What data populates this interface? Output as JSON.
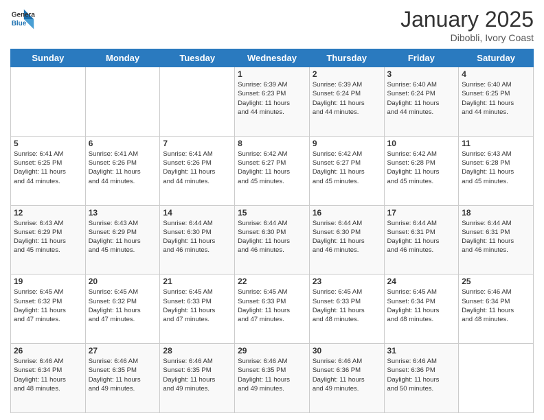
{
  "logo": {
    "line1": "General",
    "line2": "Blue"
  },
  "title": "January 2025",
  "subtitle": "Dibobli, Ivory Coast",
  "header_days": [
    "Sunday",
    "Monday",
    "Tuesday",
    "Wednesday",
    "Thursday",
    "Friday",
    "Saturday"
  ],
  "weeks": [
    [
      {
        "day": "",
        "info": ""
      },
      {
        "day": "",
        "info": ""
      },
      {
        "day": "",
        "info": ""
      },
      {
        "day": "1",
        "info": "Sunrise: 6:39 AM\nSunset: 6:23 PM\nDaylight: 11 hours\nand 44 minutes."
      },
      {
        "day": "2",
        "info": "Sunrise: 6:39 AM\nSunset: 6:24 PM\nDaylight: 11 hours\nand 44 minutes."
      },
      {
        "day": "3",
        "info": "Sunrise: 6:40 AM\nSunset: 6:24 PM\nDaylight: 11 hours\nand 44 minutes."
      },
      {
        "day": "4",
        "info": "Sunrise: 6:40 AM\nSunset: 6:25 PM\nDaylight: 11 hours\nand 44 minutes."
      }
    ],
    [
      {
        "day": "5",
        "info": "Sunrise: 6:41 AM\nSunset: 6:25 PM\nDaylight: 11 hours\nand 44 minutes."
      },
      {
        "day": "6",
        "info": "Sunrise: 6:41 AM\nSunset: 6:26 PM\nDaylight: 11 hours\nand 44 minutes."
      },
      {
        "day": "7",
        "info": "Sunrise: 6:41 AM\nSunset: 6:26 PM\nDaylight: 11 hours\nand 44 minutes."
      },
      {
        "day": "8",
        "info": "Sunrise: 6:42 AM\nSunset: 6:27 PM\nDaylight: 11 hours\nand 45 minutes."
      },
      {
        "day": "9",
        "info": "Sunrise: 6:42 AM\nSunset: 6:27 PM\nDaylight: 11 hours\nand 45 minutes."
      },
      {
        "day": "10",
        "info": "Sunrise: 6:42 AM\nSunset: 6:28 PM\nDaylight: 11 hours\nand 45 minutes."
      },
      {
        "day": "11",
        "info": "Sunrise: 6:43 AM\nSunset: 6:28 PM\nDaylight: 11 hours\nand 45 minutes."
      }
    ],
    [
      {
        "day": "12",
        "info": "Sunrise: 6:43 AM\nSunset: 6:29 PM\nDaylight: 11 hours\nand 45 minutes."
      },
      {
        "day": "13",
        "info": "Sunrise: 6:43 AM\nSunset: 6:29 PM\nDaylight: 11 hours\nand 45 minutes."
      },
      {
        "day": "14",
        "info": "Sunrise: 6:44 AM\nSunset: 6:30 PM\nDaylight: 11 hours\nand 46 minutes."
      },
      {
        "day": "15",
        "info": "Sunrise: 6:44 AM\nSunset: 6:30 PM\nDaylight: 11 hours\nand 46 minutes."
      },
      {
        "day": "16",
        "info": "Sunrise: 6:44 AM\nSunset: 6:30 PM\nDaylight: 11 hours\nand 46 minutes."
      },
      {
        "day": "17",
        "info": "Sunrise: 6:44 AM\nSunset: 6:31 PM\nDaylight: 11 hours\nand 46 minutes."
      },
      {
        "day": "18",
        "info": "Sunrise: 6:44 AM\nSunset: 6:31 PM\nDaylight: 11 hours\nand 46 minutes."
      }
    ],
    [
      {
        "day": "19",
        "info": "Sunrise: 6:45 AM\nSunset: 6:32 PM\nDaylight: 11 hours\nand 47 minutes."
      },
      {
        "day": "20",
        "info": "Sunrise: 6:45 AM\nSunset: 6:32 PM\nDaylight: 11 hours\nand 47 minutes."
      },
      {
        "day": "21",
        "info": "Sunrise: 6:45 AM\nSunset: 6:33 PM\nDaylight: 11 hours\nand 47 minutes."
      },
      {
        "day": "22",
        "info": "Sunrise: 6:45 AM\nSunset: 6:33 PM\nDaylight: 11 hours\nand 47 minutes."
      },
      {
        "day": "23",
        "info": "Sunrise: 6:45 AM\nSunset: 6:33 PM\nDaylight: 11 hours\nand 48 minutes."
      },
      {
        "day": "24",
        "info": "Sunrise: 6:45 AM\nSunset: 6:34 PM\nDaylight: 11 hours\nand 48 minutes."
      },
      {
        "day": "25",
        "info": "Sunrise: 6:46 AM\nSunset: 6:34 PM\nDaylight: 11 hours\nand 48 minutes."
      }
    ],
    [
      {
        "day": "26",
        "info": "Sunrise: 6:46 AM\nSunset: 6:34 PM\nDaylight: 11 hours\nand 48 minutes."
      },
      {
        "day": "27",
        "info": "Sunrise: 6:46 AM\nSunset: 6:35 PM\nDaylight: 11 hours\nand 49 minutes."
      },
      {
        "day": "28",
        "info": "Sunrise: 6:46 AM\nSunset: 6:35 PM\nDaylight: 11 hours\nand 49 minutes."
      },
      {
        "day": "29",
        "info": "Sunrise: 6:46 AM\nSunset: 6:35 PM\nDaylight: 11 hours\nand 49 minutes."
      },
      {
        "day": "30",
        "info": "Sunrise: 6:46 AM\nSunset: 6:36 PM\nDaylight: 11 hours\nand 49 minutes."
      },
      {
        "day": "31",
        "info": "Sunrise: 6:46 AM\nSunset: 6:36 PM\nDaylight: 11 hours\nand 50 minutes."
      },
      {
        "day": "",
        "info": ""
      }
    ]
  ]
}
